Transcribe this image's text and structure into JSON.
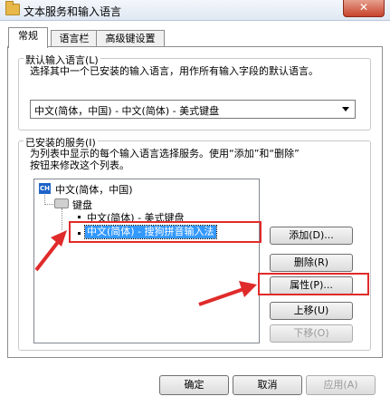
{
  "window": {
    "title": "文本服务和输入语言",
    "close_glyph": "✕"
  },
  "tabs": [
    "常规",
    "语言栏",
    "高级键设置"
  ],
  "default_language": {
    "label": "默认输入语言(L)",
    "description": "选择其中一个已安装的输入语言，用作所有输入字段的默认语言。",
    "selected": "中文(简体，中国) - 中文(简体) - 美式键盘"
  },
  "installed": {
    "label": "已安装的服务(I)",
    "description_line1": "为列表中显示的每个输入语言选择服务。使用“添加”和“删除”",
    "description_line2": "按钮来修改这个列表。",
    "tree": {
      "lang_badge": "CH",
      "lang_name": "中文(简体，中国)",
      "group_name": "键盘",
      "items": [
        "中文(简体) - 美式键盘",
        "中文(简体) - 搜狗拼音输入法"
      ]
    }
  },
  "side_buttons": {
    "add": "添加(D)...",
    "remove": "删除(R)",
    "properties": "属性(P)...",
    "move_up": "上移(U)",
    "move_down": "下移(O)"
  },
  "footer_buttons": {
    "ok": "确定",
    "cancel": "取消",
    "apply": "应用(A)"
  },
  "colors": {
    "highlight_border": "#e02b2b",
    "selection": "#3399ff"
  }
}
